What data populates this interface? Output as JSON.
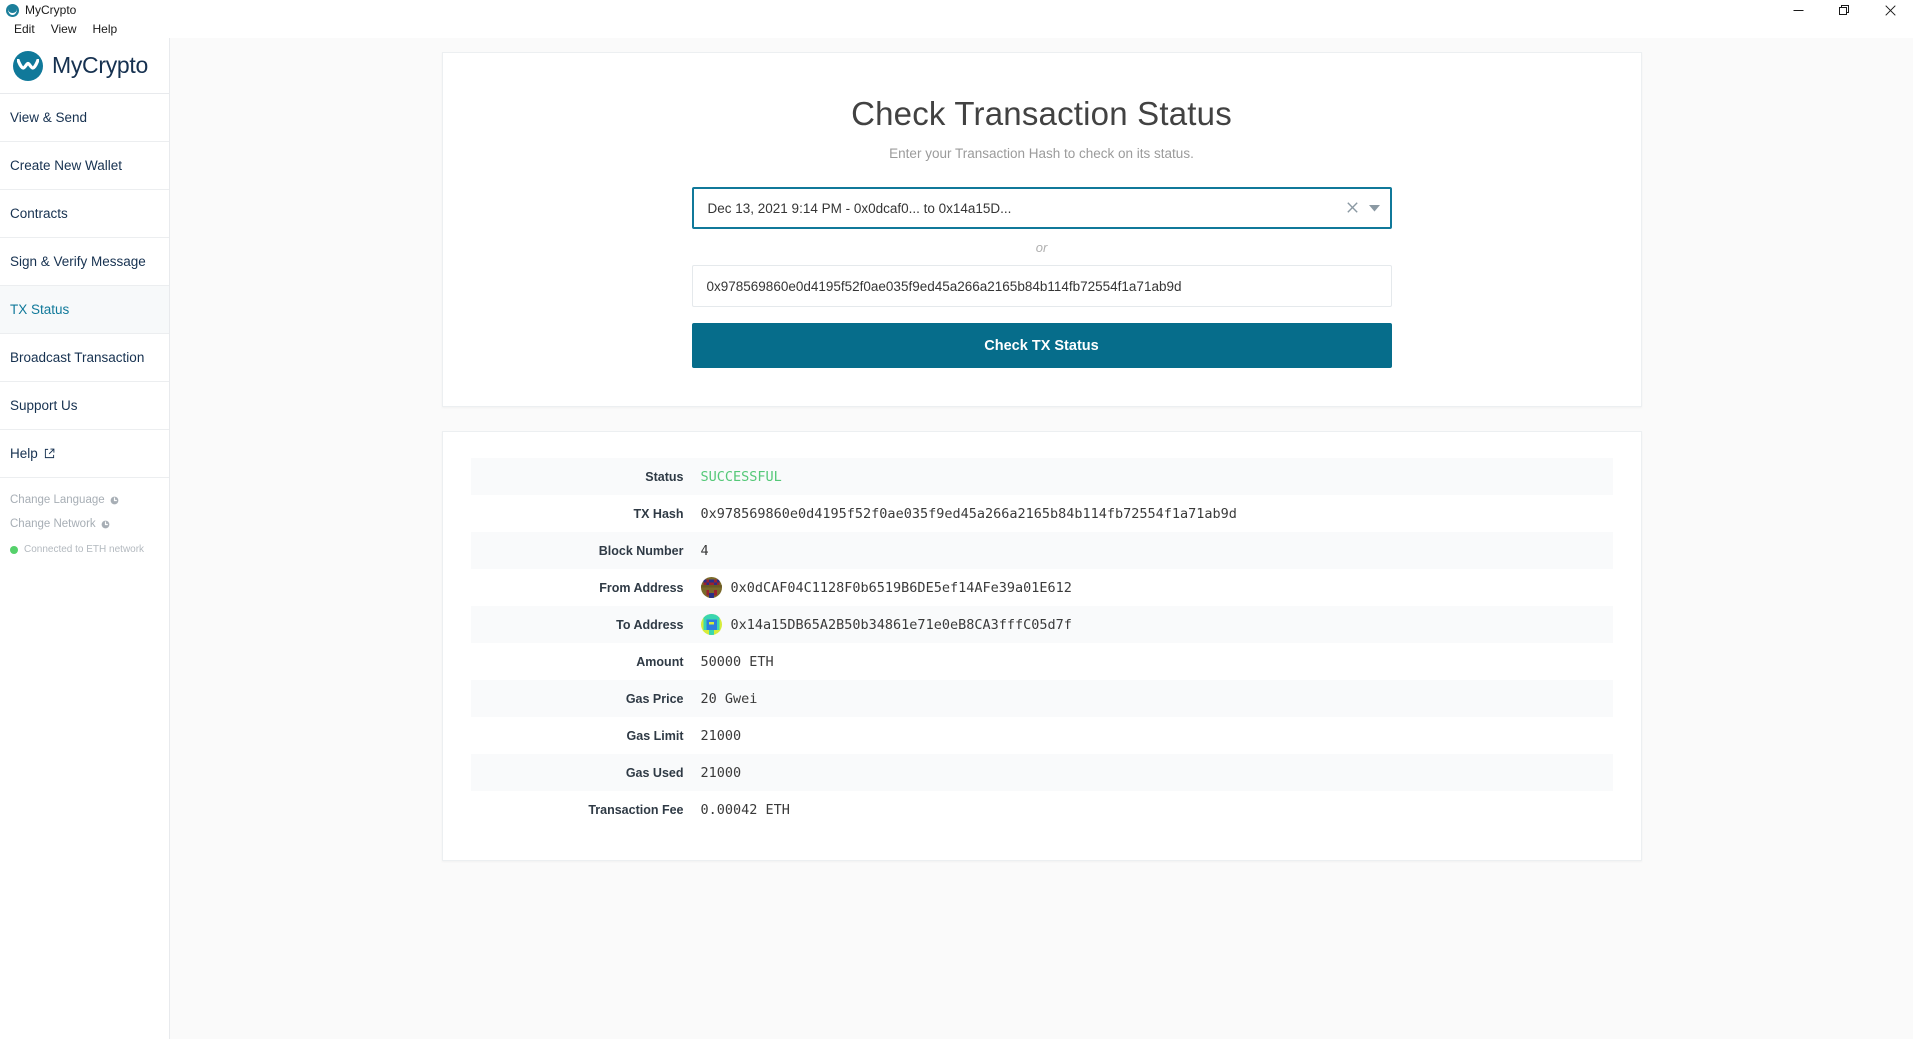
{
  "window": {
    "title": "MyCrypto",
    "icon": "mycrypto-logo-icon",
    "controls": {
      "minimize": "minimize-icon",
      "maximize": "restore-icon",
      "close": "close-icon"
    }
  },
  "menubar": {
    "items": [
      {
        "label": "Edit"
      },
      {
        "label": "View"
      },
      {
        "label": "Help"
      }
    ]
  },
  "sidebar": {
    "brand": "MyCrypto",
    "items": [
      {
        "label": "View & Send",
        "active": false,
        "external": false
      },
      {
        "label": "Create New Wallet",
        "active": false,
        "external": false
      },
      {
        "label": "Contracts",
        "active": false,
        "external": false
      },
      {
        "label": "Sign & Verify Message",
        "active": false,
        "external": false
      },
      {
        "label": "TX Status",
        "active": true,
        "external": false
      },
      {
        "label": "Broadcast Transaction",
        "active": false,
        "external": false
      },
      {
        "label": "Support Us",
        "active": false,
        "external": false
      },
      {
        "label": "Help",
        "active": false,
        "external": true
      }
    ],
    "bottom_links": [
      {
        "label": "Change Language",
        "icon": "gear-icon"
      },
      {
        "label": "Change Network",
        "icon": "gear-icon"
      }
    ],
    "network_status": {
      "text": "Connected to ETH network",
      "dot_color": "#55d16b"
    }
  },
  "main": {
    "title": "Check Transaction Status",
    "subtitle": "Enter your Transaction Hash to check on its status.",
    "tx_select": {
      "value": "Dec 13, 2021 9:14 PM - 0x0dcaf0... to 0x14a15D...",
      "placeholder": "Select a transaction",
      "clear_icon": "close-icon",
      "caret_icon": "chevron-down-icon"
    },
    "separator": "or",
    "hash_input": {
      "value": "0x978569860e0d4195f52f0ae035f9ed45a266a2165b84b114fb72554f1a71ab9d",
      "placeholder": "Transaction Hash"
    },
    "submit_label": "Check TX Status"
  },
  "results": {
    "rows": [
      {
        "label": "Status",
        "value": "SUCCESSFUL",
        "kind": "status"
      },
      {
        "label": "TX Hash",
        "value": "0x978569860e0d4195f52f0ae035f9ed45a266a2165b84b114fb72554f1a71ab9d",
        "kind": "mono"
      },
      {
        "label": "Block Number",
        "value": "4",
        "kind": "mono"
      },
      {
        "label": "From Address",
        "value": "0x0dCAF04C1128F0b6519B6DE5ef14AFe39a01E612",
        "kind": "address",
        "identicon": "identicon-from"
      },
      {
        "label": "To Address",
        "value": "0x14a15DB65A2B50b34861e71e0eB8CA3fffC05d7f",
        "kind": "address",
        "identicon": "identicon-to"
      },
      {
        "label": "Amount",
        "value": "50000 ETH",
        "kind": "mono"
      },
      {
        "label": "Gas Price",
        "value": "20 Gwei",
        "kind": "mono"
      },
      {
        "label": "Gas Limit",
        "value": "21000",
        "kind": "mono"
      },
      {
        "label": "Gas Used",
        "value": "21000",
        "kind": "mono"
      },
      {
        "label": "Transaction Fee",
        "value": "0.00042 ETH",
        "kind": "mono"
      }
    ]
  },
  "colors": {
    "accent": "#10799a",
    "button": "#066d8b",
    "success": "#55c878",
    "sidebar_text": "#163150"
  }
}
